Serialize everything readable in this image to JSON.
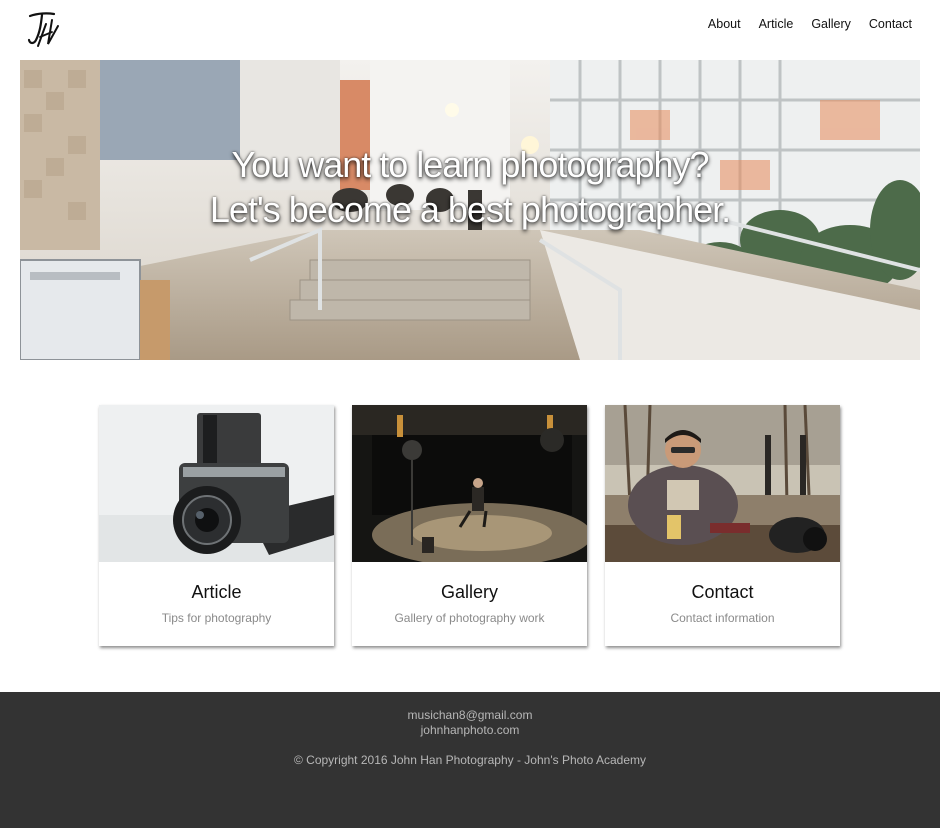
{
  "nav": {
    "items": [
      "About",
      "Article",
      "Gallery",
      "Contact"
    ]
  },
  "hero": {
    "line1": "You want to learn photography?",
    "line2": "Let's become a best photographer."
  },
  "cards": [
    {
      "title": "Article",
      "subtitle": "Tips for photography",
      "image": "camera-photo"
    },
    {
      "title": "Gallery",
      "subtitle": "Gallery of photography work",
      "image": "studio-photo"
    },
    {
      "title": "Contact",
      "subtitle": "Contact information",
      "image": "person-photo"
    }
  ],
  "footer": {
    "email": "musichan8@gmail.com",
    "website": "johnhanphoto.com",
    "copyright": "© Copyright 2016 John Han Photography - John's Photo Academy"
  },
  "colors": {
    "footer_bg": "#333333",
    "footer_text": "#b7b7b7",
    "card_subtitle": "#8a8a8a"
  }
}
